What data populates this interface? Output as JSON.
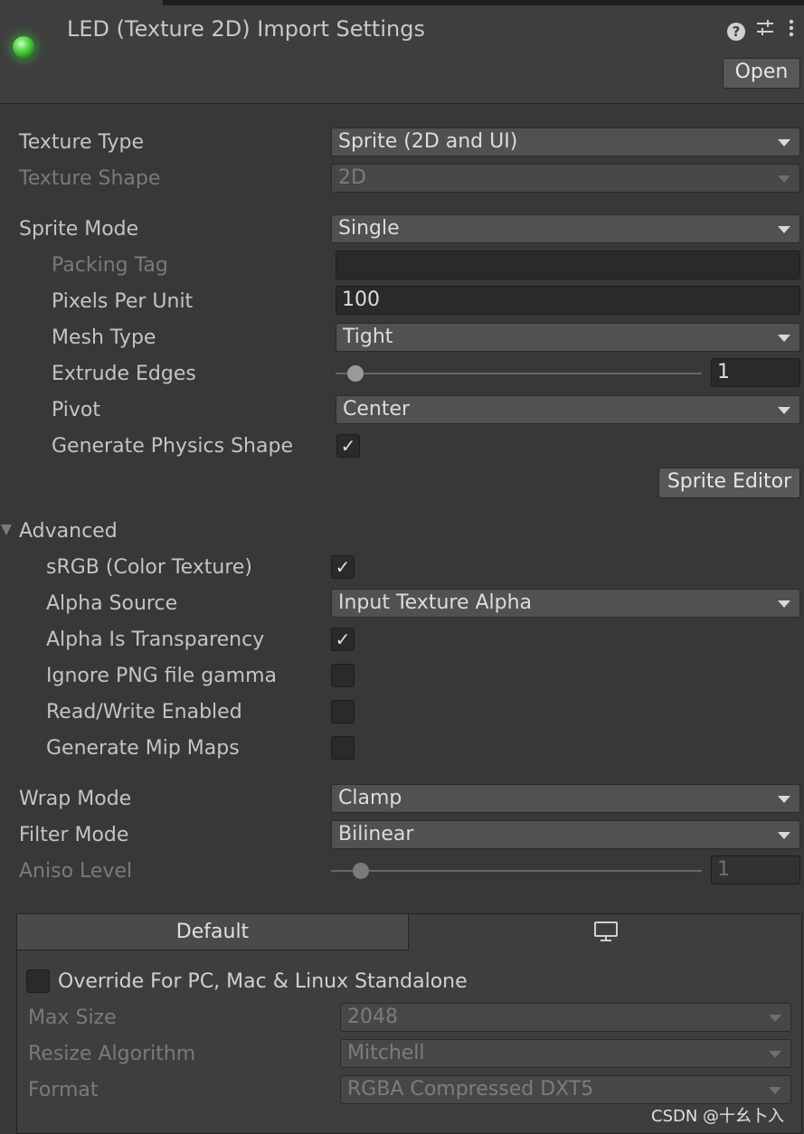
{
  "header": {
    "title": "LED (Texture 2D) Import Settings",
    "open_label": "Open",
    "icons": [
      "help-icon",
      "sliders-icon",
      "more-vertical-icon"
    ]
  },
  "main": {
    "texture_type_label": "Texture Type",
    "texture_type_value": "Sprite (2D and UI)",
    "texture_shape_label": "Texture Shape",
    "texture_shape_value": "2D",
    "sprite_mode_label": "Sprite Mode",
    "sprite_mode_value": "Single",
    "packing_tag_label": "Packing Tag",
    "packing_tag_value": "",
    "pixels_per_unit_label": "Pixels Per Unit",
    "pixels_per_unit_value": "100",
    "mesh_type_label": "Mesh Type",
    "mesh_type_value": "Tight",
    "extrude_edges_label": "Extrude Edges",
    "extrude_edges_value": "1",
    "pivot_label": "Pivot",
    "pivot_value": "Center",
    "generate_physics_shape_label": "Generate Physics Shape",
    "generate_physics_shape_checked": true,
    "sprite_editor_label": "Sprite Editor"
  },
  "advanced": {
    "header_label": "Advanced",
    "srgb_label": "sRGB (Color Texture)",
    "srgb_checked": true,
    "alpha_source_label": "Alpha Source",
    "alpha_source_value": "Input Texture Alpha",
    "alpha_is_transparency_label": "Alpha Is Transparency",
    "alpha_is_transparency_checked": true,
    "ignore_png_gamma_label": "Ignore PNG file gamma",
    "ignore_png_gamma_checked": false,
    "read_write_label": "Read/Write Enabled",
    "read_write_checked": false,
    "generate_mip_maps_label": "Generate Mip Maps",
    "generate_mip_maps_checked": false
  },
  "sampling": {
    "wrap_mode_label": "Wrap Mode",
    "wrap_mode_value": "Clamp",
    "filter_mode_label": "Filter Mode",
    "filter_mode_value": "Bilinear",
    "aniso_level_label": "Aniso Level",
    "aniso_level_value": "1"
  },
  "platform": {
    "tab_default_label": "Default",
    "tab_standalone_icon": "monitor-icon",
    "override_label": "Override For PC, Mac & Linux Standalone",
    "override_checked": false,
    "max_size_label": "Max Size",
    "max_size_value": "2048",
    "resize_algorithm_label": "Resize Algorithm",
    "resize_algorithm_value": "Mitchell",
    "format_label": "Format",
    "format_value": "RGBA Compressed DXT5"
  },
  "watermark": "CSDN @十幺卜入",
  "colors": {
    "background": "#383838",
    "header_background": "#3e3e3e",
    "led_green": "#5fd94d"
  }
}
